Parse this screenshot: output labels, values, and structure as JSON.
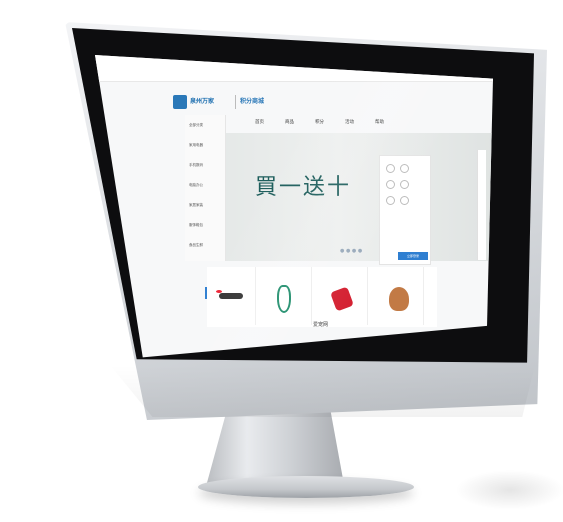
{
  "screen": {
    "utility_text": "",
    "logo_text": "泉州万家",
    "logo_sub": "",
    "mall_text": "积分商城",
    "mall_sub": "",
    "nav": [
      "首页",
      "商品",
      "积分",
      "活动",
      "帮助"
    ],
    "categories": [
      "全部分类",
      "家用电器",
      "手机数码",
      "电脑办公",
      "家居家装",
      "服饰鞋包",
      "食品生鲜"
    ],
    "hero_title": "買一送十",
    "hero_dots": "● ● ● ●",
    "right_panel_button": "立即登录",
    "products": [
      {
        "name": "",
        "price": "",
        "image": "drone"
      },
      {
        "name": "",
        "price": "",
        "image": "earphone"
      },
      {
        "name": "",
        "price": "",
        "image": "bottle"
      },
      {
        "name": "",
        "price": "",
        "image": "dog"
      }
    ],
    "section_title": "爱宠网",
    "section_sub": ""
  },
  "colors": {
    "brand_blue": "#2a78b8",
    "hero_text": "#1b5c5a",
    "bezel": "#0d0d0f",
    "aluminum": "#d6d9dd"
  }
}
